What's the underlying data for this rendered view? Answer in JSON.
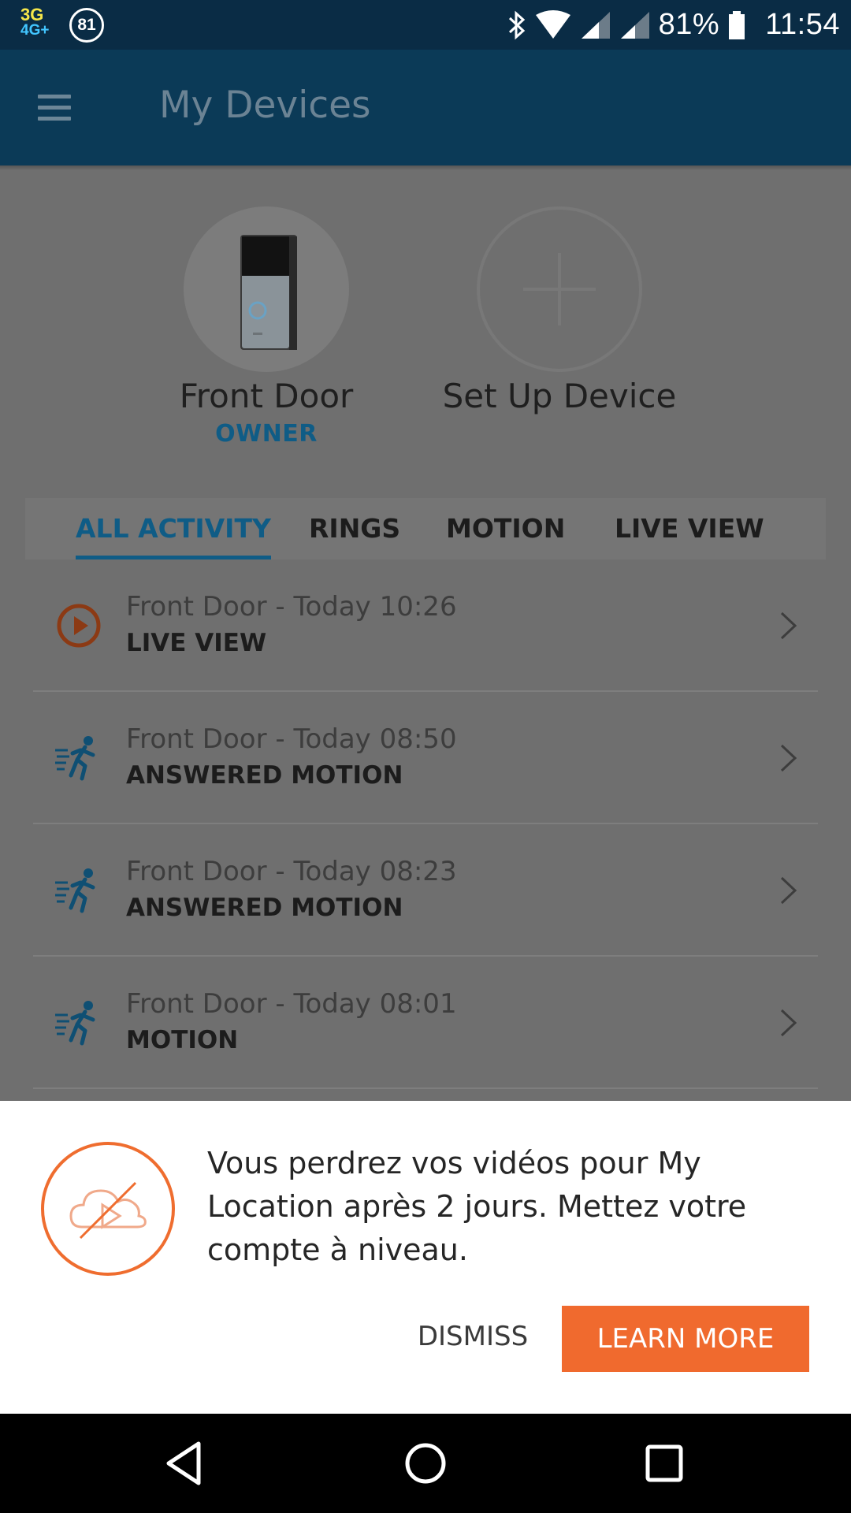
{
  "status_bar": {
    "network_top": "3G",
    "network_bottom": "4G+",
    "notification_count": "81",
    "battery": "81%",
    "time": "11:54",
    "icons": [
      "bluetooth-icon",
      "wifi-icon",
      "signal-icon",
      "signal-icon",
      "battery-icon"
    ]
  },
  "app_bar": {
    "title": "My Devices",
    "menu_icon": "hamburger-menu-icon"
  },
  "devices": [
    {
      "name": "Front Door",
      "role": "OWNER",
      "icon": "doorbell-device-icon"
    },
    {
      "name": "Set Up Device",
      "role": "",
      "icon": "plus-icon"
    }
  ],
  "tabs": [
    {
      "label": "ALL ACTIVITY",
      "active": true
    },
    {
      "label": "RINGS",
      "active": false
    },
    {
      "label": "MOTION",
      "active": false
    },
    {
      "label": "LIVE VIEW",
      "active": false
    }
  ],
  "activity": [
    {
      "time": "Front Door - Today 10:26",
      "type": "LIVE VIEW",
      "icon": "play-circle-icon"
    },
    {
      "time": "Front Door - Today 08:50",
      "type": "ANSWERED MOTION",
      "icon": "motion-runner-icon"
    },
    {
      "time": "Front Door - Today 08:23",
      "type": "ANSWERED MOTION",
      "icon": "motion-runner-icon"
    },
    {
      "time": "Front Door - Today 08:01",
      "type": "MOTION",
      "icon": "motion-runner-icon"
    }
  ],
  "banner": {
    "message": "Vous perdrez vos vidéos pour My Location après 2 jours. Mettez votre compte à niveau.",
    "dismiss_label": "DISMISS",
    "learn_more_label": "LEARN MORE",
    "icon": "cloud-video-off-icon"
  },
  "colors": {
    "app_bar": "#0b3a57",
    "accent_blue": "#0f5c86",
    "accent_orange": "#f06a2e",
    "overlay": "#6f6f6f"
  },
  "nav_bar": {
    "icons": [
      "back-icon",
      "home-icon",
      "recents-icon"
    ]
  }
}
